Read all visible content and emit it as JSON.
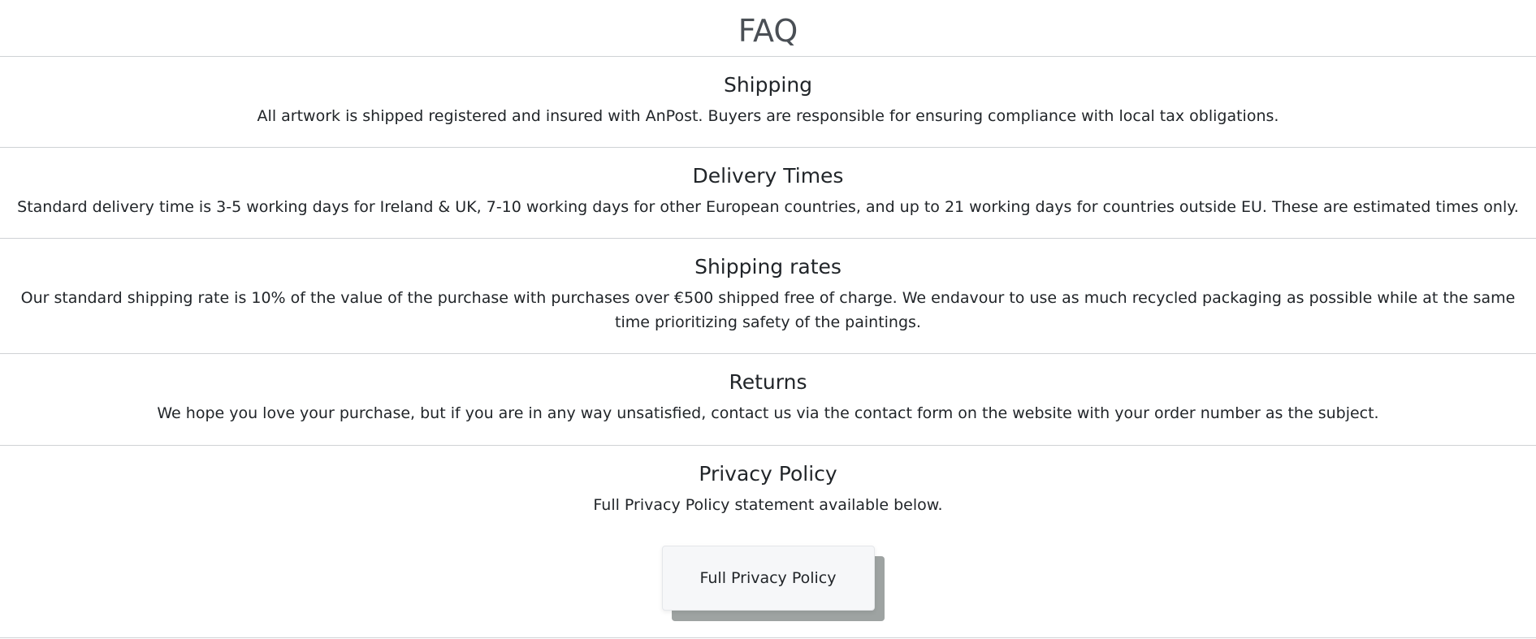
{
  "page": {
    "title": "FAQ"
  },
  "sections": [
    {
      "heading": "Shipping",
      "text": "All artwork is shipped registered and insured with AnPost. Buyers are responsible for ensuring compliance with local tax obligations."
    },
    {
      "heading": "Delivery Times",
      "text": "Standard delivery time is 3-5 working days for Ireland & UK, 7-10 working days for other European countries, and up to 21 working days for countries outside EU. These are estimated times only."
    },
    {
      "heading": "Shipping rates",
      "text": "Our standard shipping rate is 10% of the value of the purchase with purchases over €500 shipped free of charge. We endavour to use as much recycled packaging as possible while at the same time prioritizing safety of the paintings."
    },
    {
      "heading": "Returns",
      "text": "We hope you love your purchase, but if you are in any way unsatisfied, contact us via the contact form on the website with your order number as the subject."
    },
    {
      "heading": "Privacy Policy",
      "text": "Full Privacy Policy statement available below."
    }
  ],
  "privacy_button": {
    "label": "Full Privacy Policy"
  },
  "colors": {
    "title": "#4a4f55",
    "text": "#212529",
    "divider": "#cfd2d5",
    "button_bg": "#f6f7f9",
    "button_shadow": "#9ea3a2"
  }
}
